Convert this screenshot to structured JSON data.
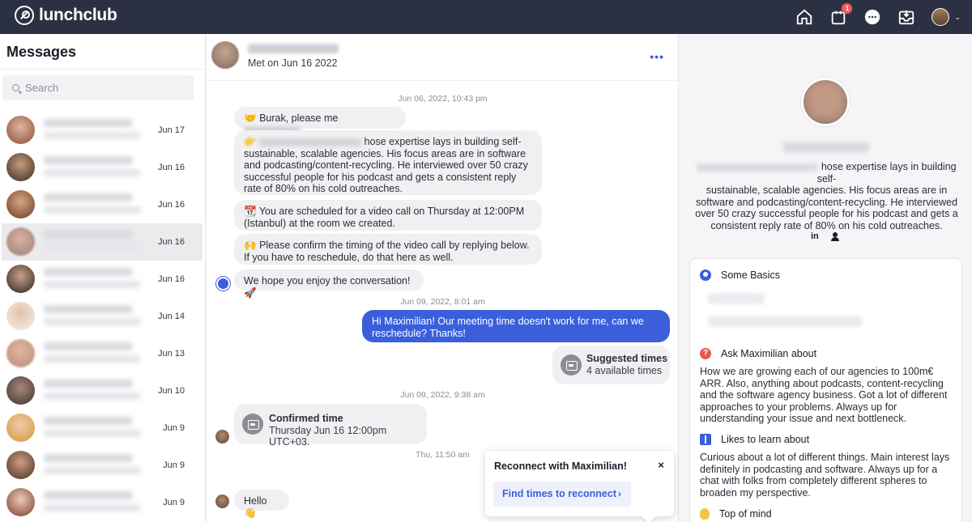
{
  "app": {
    "logo_text": "lunchclub"
  },
  "nav": {
    "notifications_badge": "1",
    "avatar_caret": "⌄"
  },
  "sidebar": {
    "title": "Messages",
    "search_placeholder": "Search",
    "conversations": [
      {
        "date": "Jun 17"
      },
      {
        "date": "Jun 16"
      },
      {
        "date": "Jun 16"
      },
      {
        "date": "Jun 16"
      },
      {
        "date": "Jun 16"
      },
      {
        "date": "Jun 14"
      },
      {
        "date": "Jun 13"
      },
      {
        "date": "Jun 10"
      },
      {
        "date": "Jun 9"
      },
      {
        "date": "Jun 9"
      },
      {
        "date": "Jun 9"
      }
    ]
  },
  "chat": {
    "met_text": "Met on Jun 16 2022",
    "more_label": "•••",
    "timestamp_1": "Jun 06, 2022, 10:43 pm",
    "msg_greeting_emoji": "🤝",
    "msg_greeting": "Burak, please me",
    "msg_intro_emoji": "👉",
    "msg_intro_line1": "hose expertise lays in building self-",
    "msg_intro_rest": "sustainable, scalable agencies. His focus areas are in software and podcasting/content-recycling. He interviewed over 50 crazy successful people for his podcast and gets a consistent reply rate of 80% on his cold outreaches.",
    "msg_schedule_emoji": "📆",
    "msg_schedule": "You are scheduled for a video call on Thursday at 12:00PM (Istanbul) at the room we created.",
    "msg_confirm_emoji": "🙌",
    "msg_confirm": "Please confirm the timing of the video call by replying below. If you have to reschedule, do that here as well.",
    "msg_enjoy": "We hope you enjoy the conversation!",
    "msg_enjoy_emoji": "🚀",
    "timestamp_2": "Jun 09, 2022, 8:01 am",
    "msg_out": "Hi Maximilian! Our meeting time doesn't work for me, can we reschedule? Thanks!",
    "suggested_title": "Suggested times",
    "suggested_sub": "4 available times",
    "timestamp_3": "Jun 09, 2022, 9:38 am",
    "confirmed_title": "Confirmed time",
    "confirmed_sub": "Thursday Jun 16 12:00pm UTC+03.",
    "timestamp_4": "Thu, 11:50 am",
    "msg_hello": "Hello",
    "msg_hello_emoji": "👋"
  },
  "popup": {
    "title": "Reconnect with Maximilian!",
    "close_label": "×",
    "button_label": "Find times to reconnect",
    "button_arrow": "›"
  },
  "profile": {
    "bio_line1": "hose expertise lays in building self-",
    "bio_rest": "sustainable, scalable agencies. His focus areas are in software and podcasting/content-recycling. He interviewed over 50 crazy successful people for his podcast and gets a consistent reply rate of 80% on his cold outreaches.",
    "linkedin_label": "in",
    "basics_title": "Some Basics",
    "ask_title": "Ask Maximilian about",
    "ask_text": "How we are growing each of our agencies to 100m€ ARR. Also, anything about podcasts, content-recycling and the software agency business. Got a lot of different approaches to your problems. Always up for understanding your issue and next bottleneck.",
    "learn_title": "Likes to learn about",
    "learn_text": "Curious about a lot of different things. Main interest lays definitely in podcasting and software. Always up for a chat with folks from completely different spheres to broaden my perspective.",
    "mind_title": "Top of mind"
  }
}
